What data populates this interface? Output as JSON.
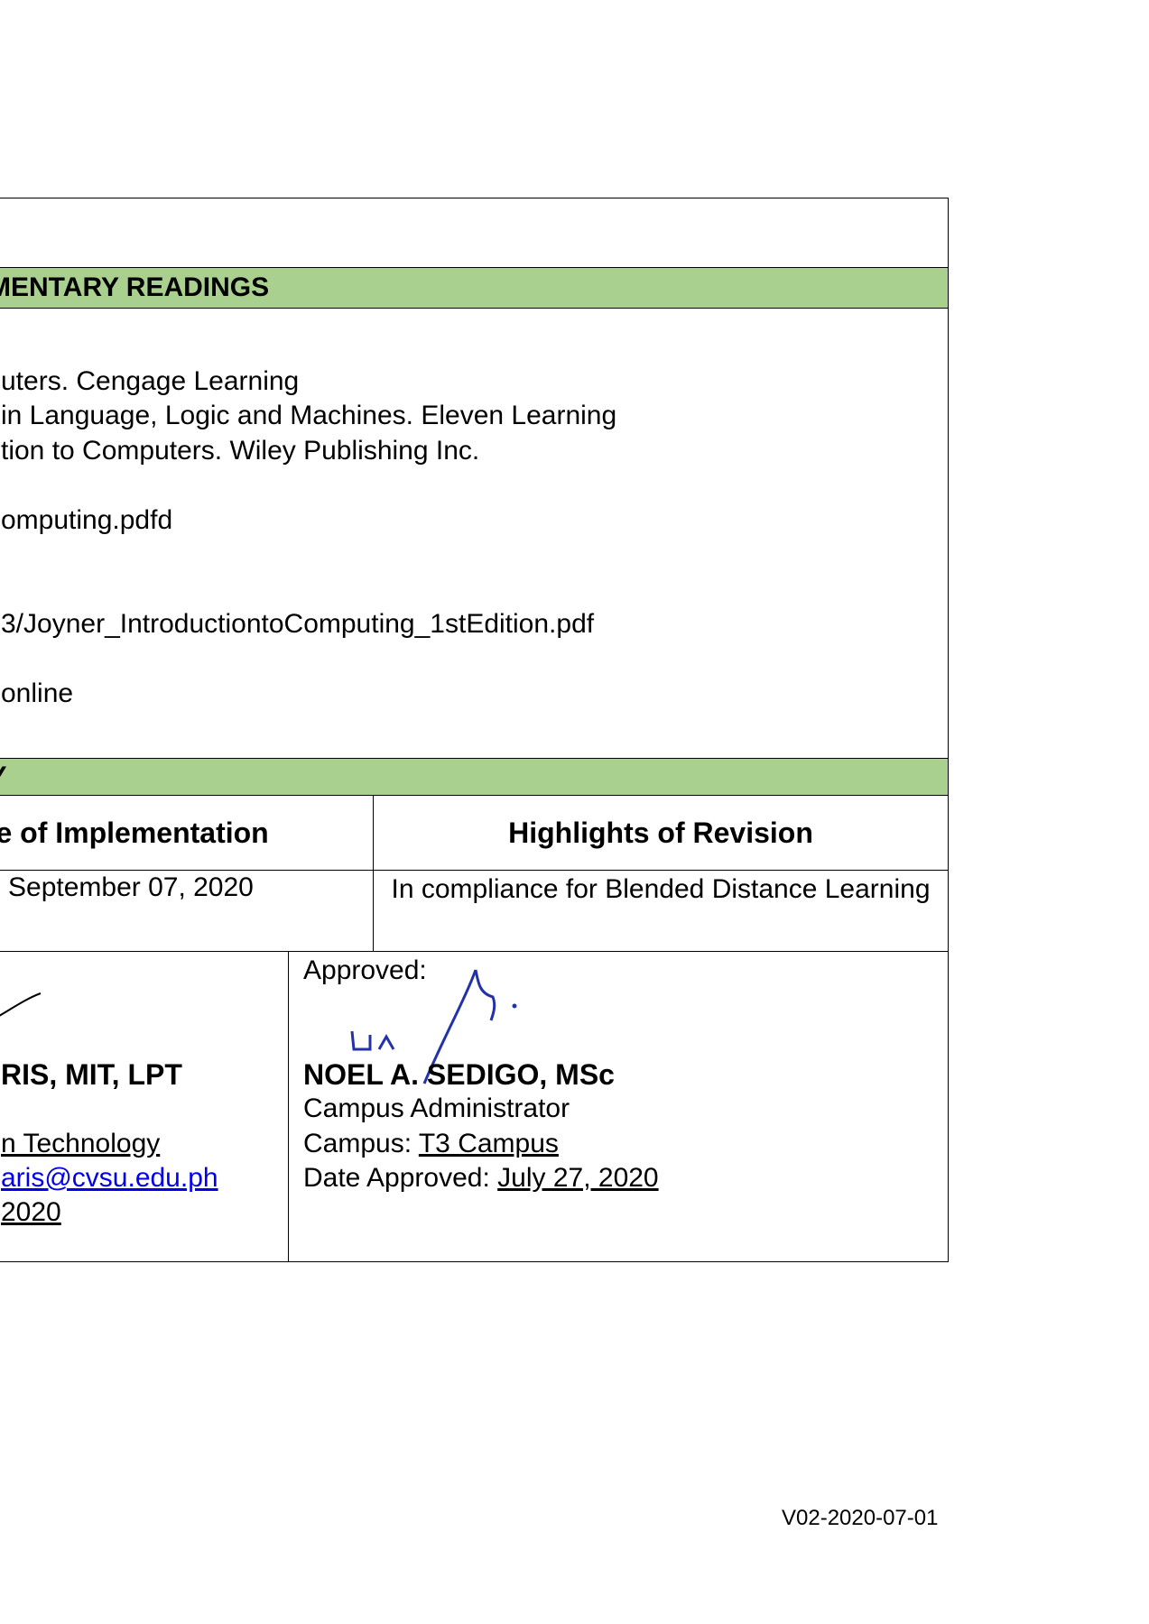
{
  "readings": {
    "header": "EMENTARY READINGS",
    "lines": [
      "uters. Cengage Learning",
      " in Language, Logic and Machines. Eleven Learning",
      "tion to Computers. Wiley Publishing Inc.",
      "omputing.pdfd",
      "3/Joyner_IntroductiontoComputing_1stEdition.pdf",
      " online"
    ]
  },
  "revision": {
    "header": "RY",
    "col_date": "ate of Implementation",
    "col_highlights": "Highlights of Revision",
    "date_value": "September 07, 2020",
    "highlights_value": "In compliance for Blended Distance Learning"
  },
  "prepared": {
    "name": "RIS, MIT, LPT",
    "department": "n Technology",
    "email": "aris@cvsu.edu.ph",
    "date": "2020"
  },
  "approved": {
    "label": "Approved:",
    "name": "NOEL A. SEDIGO, MSc",
    "title": "Campus Administrator",
    "campus_label": "Campus: ",
    "campus_value": "T3 Campus",
    "date_label": "Date Approved: ",
    "date_value": "July 27, 2020"
  },
  "footer": {
    "version": "V02-2020-07-01"
  }
}
